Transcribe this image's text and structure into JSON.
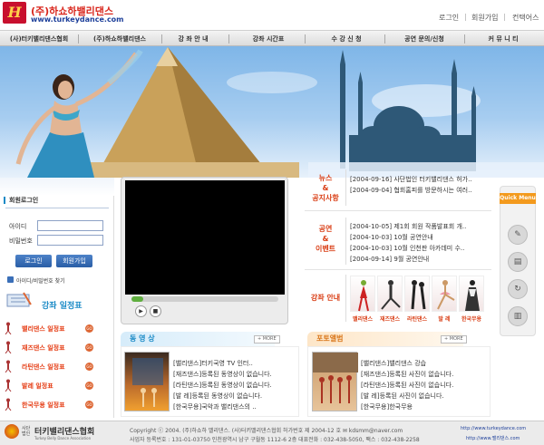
{
  "header": {
    "logo_letter": "H",
    "title": "(주)하쇼하밸리댄스",
    "url": "www.turkeydance.com",
    "util_links": [
      "로그인",
      "회원가입",
      "컨택어스"
    ]
  },
  "nav": {
    "items": [
      "(사)터키밸리댄스협회",
      "(주)하쇼하밸리댄스",
      "강 좌 안 내",
      "강좌 시간표",
      "수 강 신 청",
      "공연 문의/신청",
      "커 뮤 니 티"
    ]
  },
  "login": {
    "title": "회원로그인",
    "id_label": "아이디",
    "pw_label": "비밀번호",
    "id_value": "",
    "pw_value": "",
    "login_button": "로그인",
    "join_button": "회원가입",
    "find_link": "아이디/비밀번호 찾기"
  },
  "schedule": {
    "title": "강좌 일정표",
    "items": [
      "밸리댄스 일정표",
      "재즈댄스 일정표",
      "라틴댄스 일정표",
      "발레 일정표",
      "한국무용 일정표"
    ]
  },
  "player": {
    "progress": 0.08
  },
  "news": {
    "label_top": "뉴스",
    "label_amp": "&",
    "label_bottom": "공지사항",
    "items": [
      "[2004-09-16] 사단법인 터키밸리댄스 허가..",
      "[2004-09-04] 협회홈피를 방문하시는 여러.."
    ]
  },
  "events": {
    "label_top": "공연",
    "label_amp": "&",
    "label_bottom": "이벤트",
    "items": [
      "[2004-10-05] 제1회 회원 작품발표회 개..",
      "[2004-10-03] 10월 공연안내",
      "[2004-10-03] 10월 인천판 아카데미 수..",
      "[2004-09-14] 9월 공연안내"
    ]
  },
  "courses": {
    "label": "강좌 안내",
    "items": [
      "밸리댄스",
      "재즈댄스",
      "라틴댄스",
      "발 레",
      "한국무용"
    ]
  },
  "quick_menu": {
    "title": "Quick Menu",
    "icons": [
      "note-icon",
      "layers-icon",
      "refresh-icon",
      "document-icon"
    ]
  },
  "video": {
    "title": "동 영 상",
    "more": "+ MORE",
    "items": [
      "[밸리댄스]터키국영 TV 인터..",
      "[재즈댄스]등록된 동영상이 없습니다.",
      "[라틴댄스]등록된 동영상이 없습니다.",
      "[발      레]등록된 동영상이 없습니다.",
      "[한국무용]국악과 밸리댄스의 .."
    ]
  },
  "photo": {
    "title": "포토앨범",
    "more": "+ MORE",
    "items": [
      "[밸리댄스]밸리댄스 강습",
      "[재즈댄스]등록된 사진이 없습니다.",
      "[라틴댄스]등록된 사진이 없습니다.",
      "[발      레]등록된 사진이 없습니다.",
      "[한국무용]한국무용"
    ]
  },
  "footer": {
    "assoc_prefix": "사단",
    "assoc_prefix2": "법인",
    "assoc_name": "터키밸리댄스협회",
    "assoc_en": "Turkey Belly Dance Association",
    "line1": "Copyright ⓒ 2004. (주)하쇼하 밸리댄스. (사)터키밸리댄스협회 허가번호 제 2004-12 호  ✉ kdsmm@naver.com",
    "line2": "사업자 등록번호 : 131-01-03750   인천광역시 남구 구월동 1112-6 2층  대표전화 : 032-438-5050,  팩스 : 032-438-2258",
    "url1": "http://www.turkeydance.com",
    "url2": "http://www.밸리댄스.com"
  },
  "colors": {
    "accent_red": "#d93d14",
    "nav_blue": "#1a8ac6",
    "quick_orange": "#f39a1d"
  }
}
